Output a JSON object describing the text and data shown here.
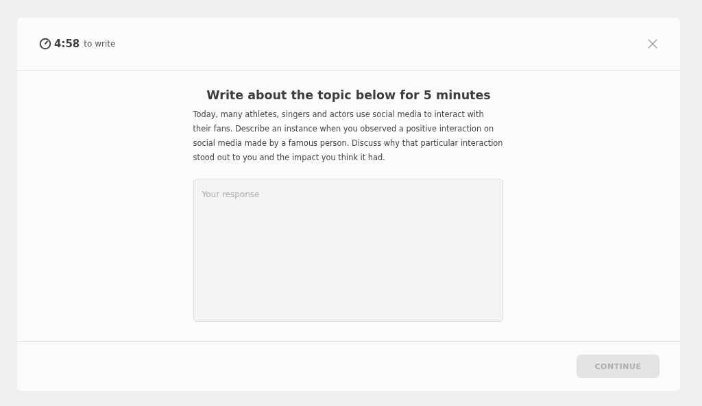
{
  "timer": {
    "time": "4:58",
    "label": "to write"
  },
  "prompt": {
    "title": "Write about the topic below for 5 minutes",
    "text": "Today, many athletes, singers and actors use social media to interact with their fans. Describe an instance when you observed a positive interaction on social media made by a famous person. Discuss why that particular interaction stood out to you and the impact you think it had."
  },
  "response": {
    "placeholder": "Your response"
  },
  "continue_button": {
    "label": "CONTINUE",
    "disabled": true
  }
}
